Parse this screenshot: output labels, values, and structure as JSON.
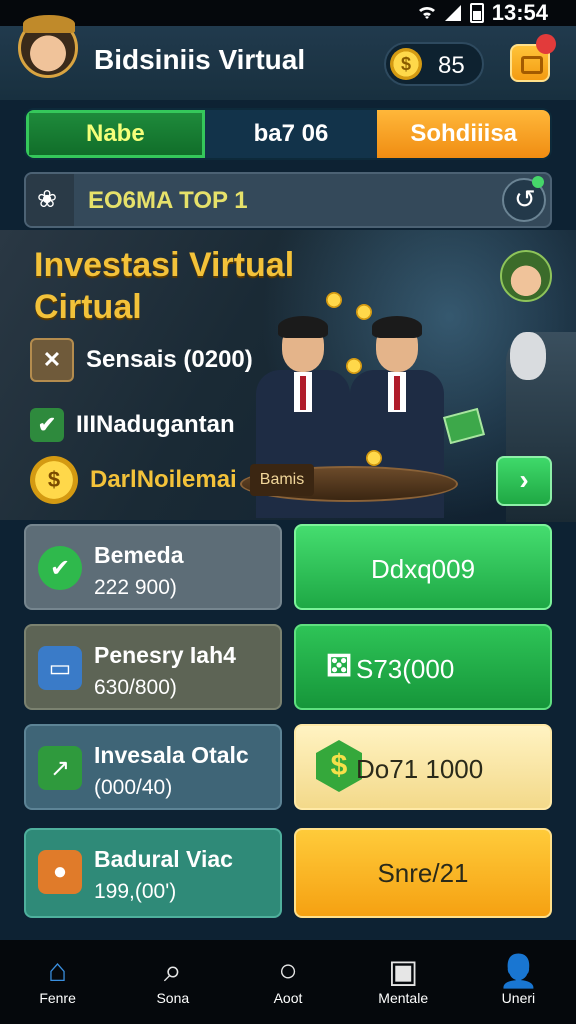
{
  "status_bar": {
    "time": "13:54",
    "battery_icon": "battery-icon",
    "signal_icon": "signal-icon",
    "wifi_icon": "wifi-icon"
  },
  "header": {
    "title": "Bidsiniis Virtual",
    "coin_count": "85",
    "coin_symbol": "$",
    "notification_count": ""
  },
  "tabs": [
    {
      "label": "Nabe"
    },
    {
      "label": "ba7 06"
    },
    {
      "label": "Sohdiiisa"
    }
  ],
  "search": {
    "text": "EO6MA TOP 1"
  },
  "hero": {
    "title_line1": "Investasi Virtual",
    "title_line2": "Cirtual",
    "row1": "Sensais (0200)",
    "row2": "IIINadugantan",
    "row3": "DarlNoilemai",
    "desk_sign": "Bamis"
  },
  "cards": [
    {
      "title": "Bemeda",
      "value": "222 900)",
      "action": "Ddxq009"
    },
    {
      "title": "Penesry Iah4",
      "value": "630/800)",
      "action": "S73(000"
    },
    {
      "title": "Invesala Otalc",
      "value": "(000/40)",
      "action": "Do71 1000"
    },
    {
      "title": "Badural Viac",
      "value": "199,(00')",
      "action": "Snre/21"
    }
  ],
  "nav": [
    {
      "label": "Fenre",
      "icon": "home-icon"
    },
    {
      "label": "Sona",
      "icon": "search-icon"
    },
    {
      "label": "Aoot",
      "icon": "circle-icon"
    },
    {
      "label": "Mentale",
      "icon": "gift-icon"
    },
    {
      "label": "Uneri",
      "icon": "user-icon"
    }
  ],
  "colors": {
    "accent_gold": "#f3c23a",
    "accent_green": "#2fb94c",
    "accent_orange": "#f5a112"
  }
}
